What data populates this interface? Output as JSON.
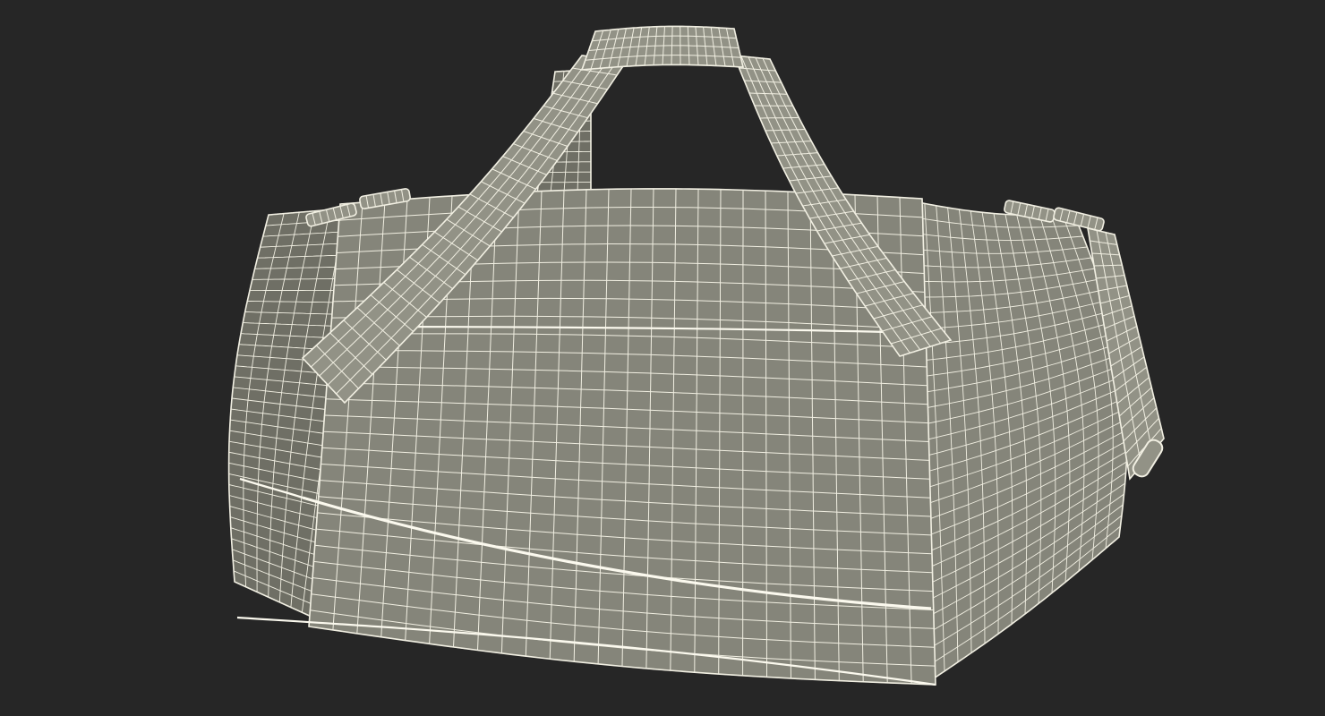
{
  "scene": {
    "subject": "duffel-bag-wireframe",
    "colors": {
      "background": "#262626",
      "surface": "#85857a",
      "surface_dark": "#6f6f65",
      "surface_light": "#929286",
      "wire": "#f1efe2",
      "seam": "#fbf9ee"
    }
  }
}
